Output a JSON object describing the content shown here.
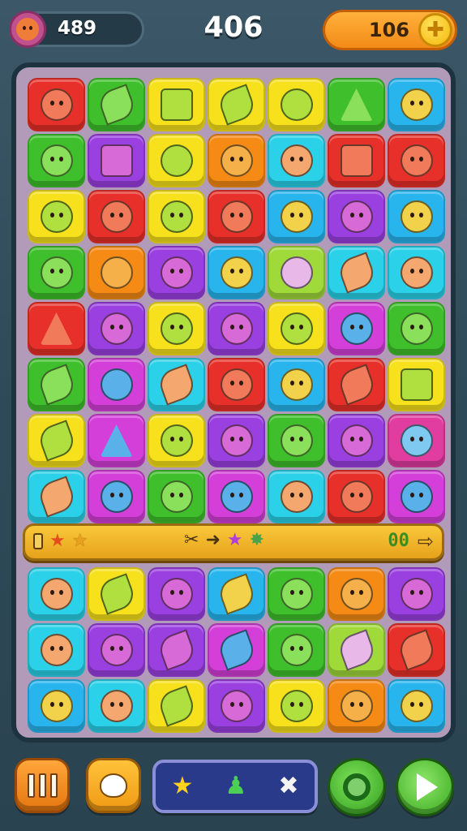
{
  "header": {
    "player_score": "489",
    "center_score": "406",
    "coins": "106"
  },
  "board": {
    "rows_top": [
      [
        "red",
        "green",
        "yellow",
        "yellow",
        "yellow",
        "green",
        "blue"
      ],
      [
        "green",
        "purple",
        "yellow",
        "orange",
        "cyan",
        "red",
        "red"
      ],
      [
        "yellow",
        "red",
        "yellow",
        "red",
        "blue",
        "purple",
        "blue"
      ],
      [
        "green",
        "orange",
        "purple",
        "blue",
        "lime",
        "cyan",
        "cyan"
      ],
      [
        "red",
        "purple",
        "yellow",
        "purple",
        "yellow",
        "magenta",
        "green"
      ],
      [
        "green",
        "magenta",
        "cyan",
        "red",
        "blue",
        "red",
        "yellow"
      ],
      [
        "yellow",
        "magenta",
        "yellow",
        "purple",
        "green",
        "purple",
        "pink"
      ],
      [
        "cyan",
        "magenta",
        "green",
        "magenta",
        "cyan",
        "red",
        "magenta"
      ]
    ],
    "rows_bottom": [
      [
        "cyan",
        "yellow",
        "purple",
        "blue",
        "green",
        "orange",
        "purple"
      ],
      [
        "cyan",
        "purple",
        "purple",
        "magenta",
        "green",
        "lime",
        "red"
      ],
      [
        "blue",
        "cyan",
        "yellow",
        "purple",
        "yellow",
        "orange",
        "blue"
      ]
    ],
    "icons_top": [
      [
        "face",
        "leaf",
        "square",
        "leaf",
        "star",
        "tri",
        "face"
      ],
      [
        "face",
        "square",
        "plain",
        "face",
        "face",
        "square",
        "face"
      ],
      [
        "face",
        "face",
        "face",
        "face",
        "face",
        "face",
        "face"
      ],
      [
        "face",
        "plain",
        "face",
        "face",
        "plain",
        "leaf",
        "face"
      ],
      [
        "tri",
        "face",
        "face",
        "face",
        "face",
        "face",
        "face"
      ],
      [
        "leaf",
        "plain",
        "leaf",
        "face",
        "face",
        "leaf",
        "square"
      ],
      [
        "leaf",
        "tri",
        "face",
        "face",
        "face",
        "face",
        "face"
      ],
      [
        "leaf",
        "face",
        "face",
        "face",
        "face",
        "face",
        "face"
      ]
    ],
    "icons_bottom": [
      [
        "face",
        "leaf",
        "face",
        "leaf",
        "face",
        "face",
        "face"
      ],
      [
        "face",
        "face",
        "leaf",
        "leaf",
        "face",
        "leaf",
        "leaf"
      ],
      [
        "face",
        "face",
        "leaf",
        "face",
        "face",
        "face",
        "face"
      ]
    ]
  },
  "combo_bar": {
    "counter": "00"
  },
  "controls": {
    "pause_icon": "pause-icon",
    "hint_icon": "bubble-icon",
    "powerups": [
      "star-icon",
      "person-icon",
      "cross-icon"
    ],
    "swirl_icon": "swirl-icon",
    "play_icon": "play-icon"
  }
}
